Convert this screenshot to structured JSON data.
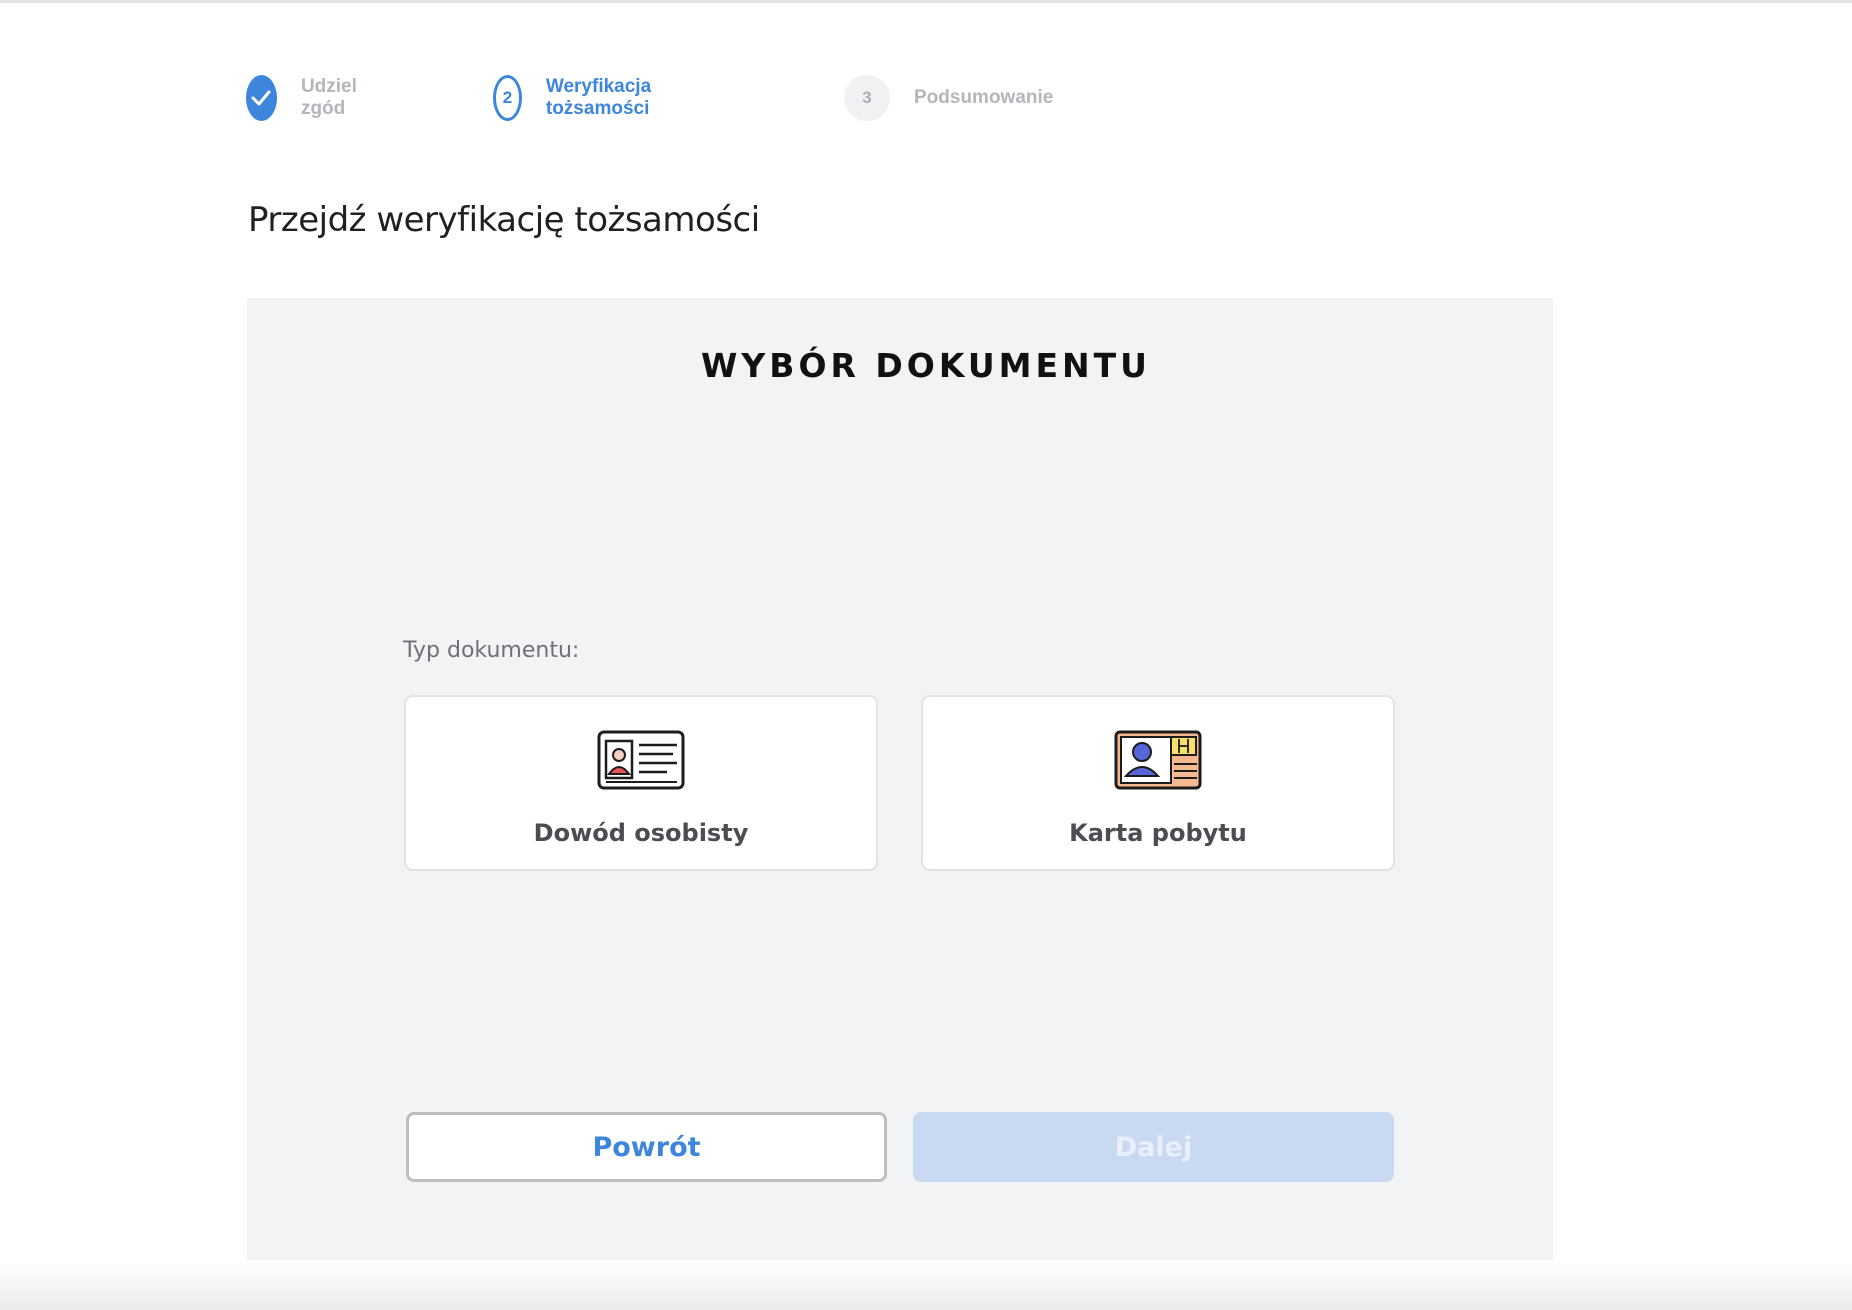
{
  "stepper": {
    "steps": [
      {
        "number": "✓",
        "label": "Udziel zgód",
        "state": "done"
      },
      {
        "number": "2",
        "label": "Weryfikacja tożsamości",
        "state": "active"
      },
      {
        "number": "3",
        "label": "Podsumowanie",
        "state": "todo"
      }
    ]
  },
  "page": {
    "title": "Przejdź weryfikację tożsamości"
  },
  "panel": {
    "heading": "WYBÓR DOKUMENTU",
    "field_label": "Typ dokumentu:",
    "options": [
      {
        "label": "Dowód osobisty",
        "icon": "id-card-icon"
      },
      {
        "label": "Karta pobytu",
        "icon": "residence-card-icon"
      }
    ],
    "back_label": "Powrót",
    "next_label": "Dalej"
  },
  "colors": {
    "accent": "#3d86dc",
    "panel_bg": "#f2f3f5",
    "disabled_button_bg": "#c8d9f1"
  }
}
